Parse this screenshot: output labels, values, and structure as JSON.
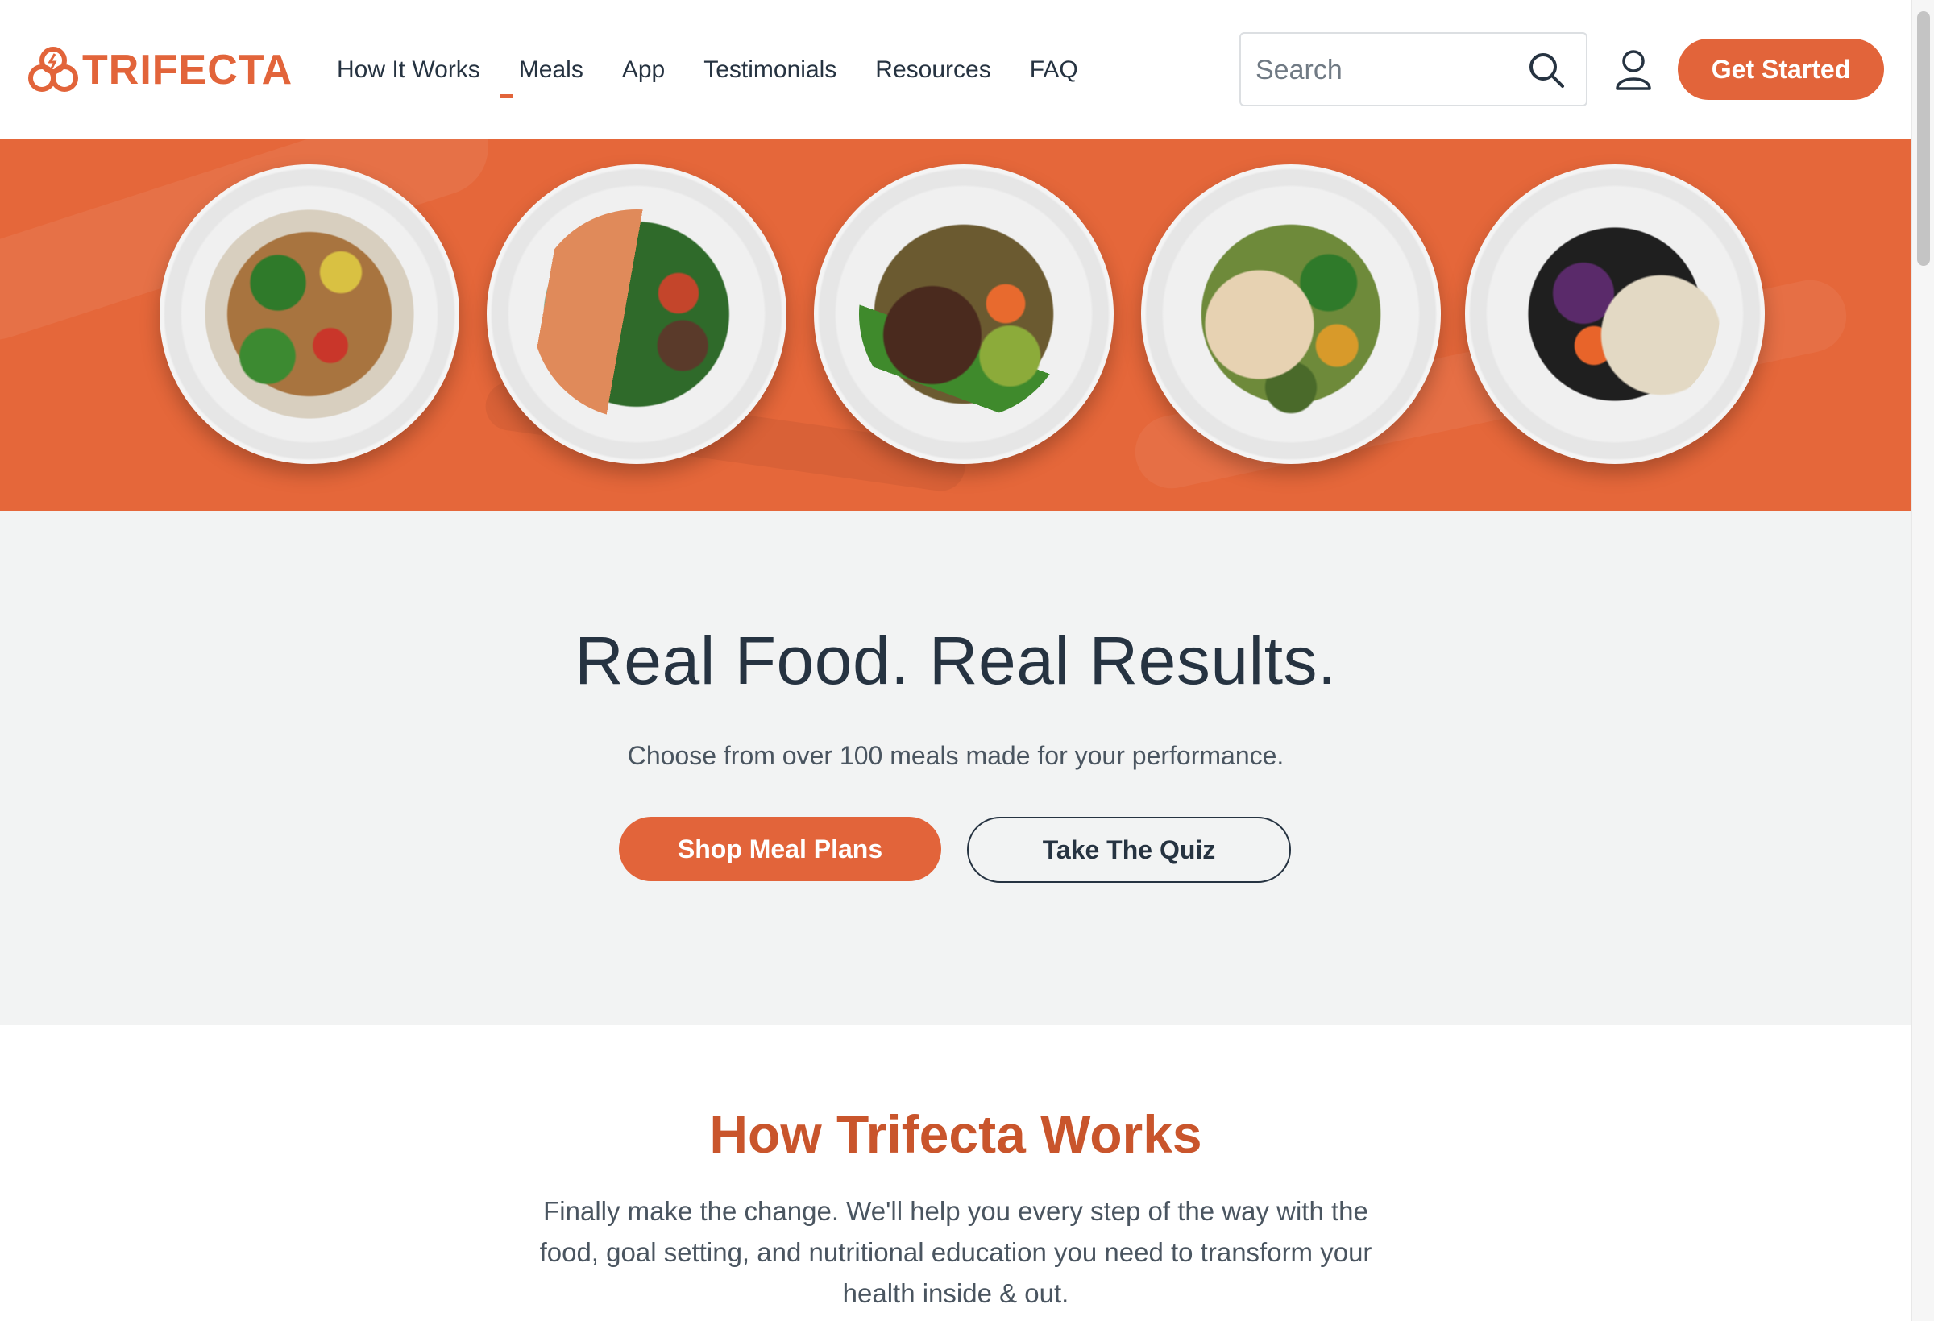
{
  "brand": {
    "name": "TRIFECTA",
    "accent_color": "#e2643a",
    "dark_color": "#263341"
  },
  "nav": {
    "items": [
      {
        "label": "How It Works",
        "active": false
      },
      {
        "label": "Meals",
        "active": true
      },
      {
        "label": "App",
        "active": false
      },
      {
        "label": "Testimonials",
        "active": false
      },
      {
        "label": "Resources",
        "active": false
      },
      {
        "label": "FAQ",
        "active": false
      }
    ]
  },
  "search": {
    "placeholder": "Search",
    "value": ""
  },
  "header": {
    "cta_label": "Get Started"
  },
  "hero_banner": {
    "background_color": "#e5673a",
    "plates": [
      {
        "icon": "chicken-stir-fry-plate"
      },
      {
        "icon": "salmon-vegetables-plate"
      },
      {
        "icon": "steak-green-beans-plate"
      },
      {
        "icon": "grilled-chicken-vegetables-plate"
      },
      {
        "icon": "black-bean-rice-plate"
      }
    ]
  },
  "hero": {
    "headline": "Real Food. Real Results.",
    "subline": "Choose from over 100 meals made for your performance.",
    "primary_button": "Shop Meal Plans",
    "secondary_button": "Take The Quiz"
  },
  "how_it_works": {
    "title": "How Trifecta Works",
    "description": "Finally make the change. We'll help you every step of the way with the food, goal setting, and nutritional education you need to transform your health inside & out."
  }
}
